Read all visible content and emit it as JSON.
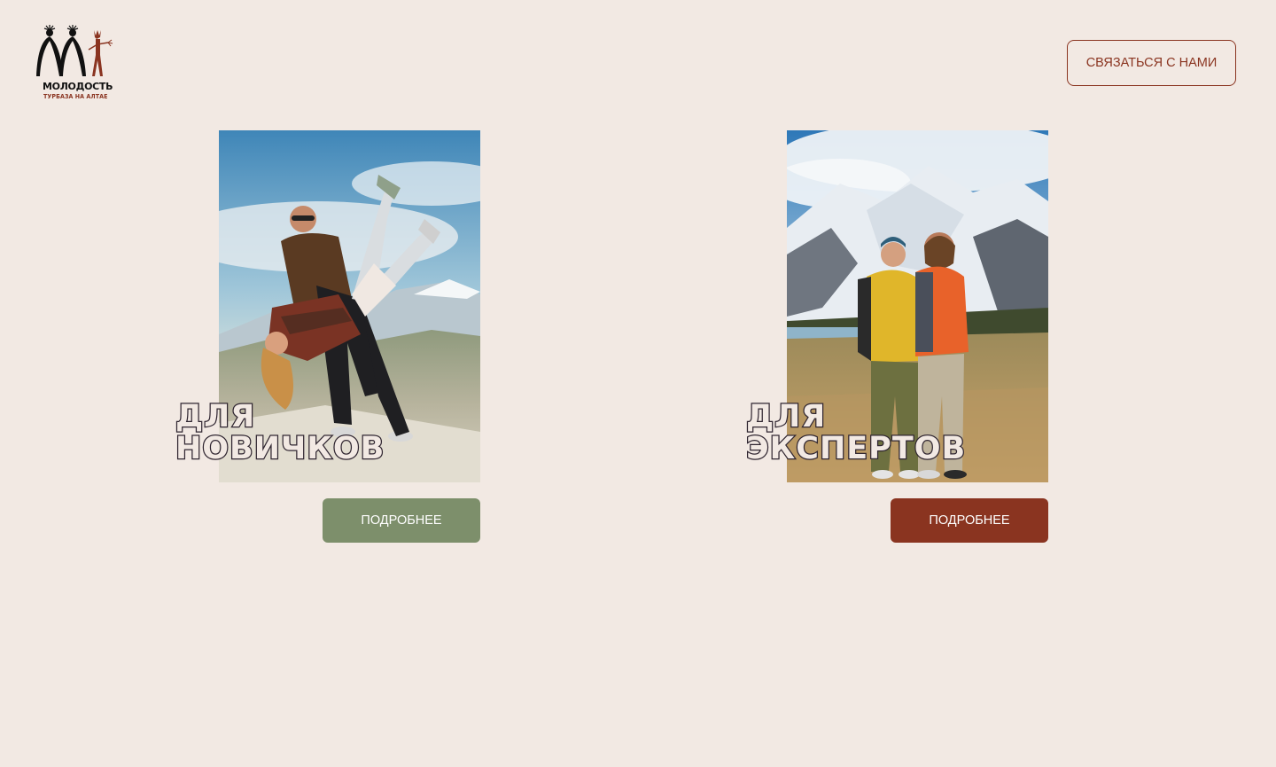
{
  "logo": {
    "name": "МОЛОДОСТЬ",
    "subtitle": "ТУРБАЗА НА АЛТАЕ",
    "accent_color": "#8a3420"
  },
  "header": {
    "contact_label": "СВЯЗАТЬСЯ С НАМИ"
  },
  "cards": [
    {
      "title_line1": "ДЛЯ",
      "title_line2": "НОВИЧКОВ",
      "button_label": "ПОДРОБНЕЕ",
      "button_color": "#7d8f6b"
    },
    {
      "title_line1": "ДЛЯ",
      "title_line2": "ЭКСПЕРТОВ",
      "button_label": "ПОДРОБНЕЕ",
      "button_color": "#8a3420"
    }
  ],
  "colors": {
    "background": "#f2e9e3",
    "accent": "#8a3420",
    "green": "#7d8f6b"
  }
}
